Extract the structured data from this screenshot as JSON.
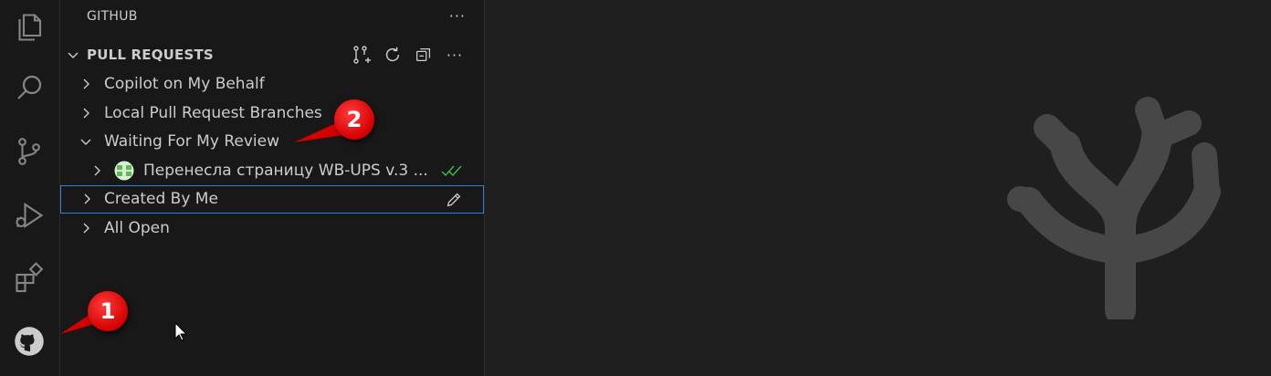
{
  "activity_bar": {
    "items": [
      {
        "icon": "explorer-icon"
      },
      {
        "icon": "search-icon"
      },
      {
        "icon": "source-control-icon"
      },
      {
        "icon": "run-debug-icon"
      },
      {
        "icon": "extensions-icon"
      },
      {
        "icon": "github-icon"
      }
    ]
  },
  "sidebar": {
    "title": "GITHUB",
    "more": "···",
    "section": {
      "label": "PULL REQUESTS",
      "actions": [
        "create-pull-request-icon",
        "refresh-icon",
        "collapse-all-icon",
        "more-icon"
      ],
      "more": "···"
    },
    "tree": [
      {
        "label": "Copilot on My Behalf",
        "expanded": false
      },
      {
        "label": "Local Pull Request Branches",
        "expanded": false
      },
      {
        "label": "Waiting For My Review",
        "expanded": true
      },
      {
        "label": "Перенесла страницу WB-UPS v.3 ...",
        "expanded": false,
        "child": true,
        "status": "approved-check-icon"
      },
      {
        "label": "Created By Me",
        "expanded": false,
        "selected": true,
        "action": "edit-icon"
      },
      {
        "label": "All Open",
        "expanded": false
      }
    ]
  },
  "annotations": [
    {
      "number": "1"
    },
    {
      "number": "2"
    }
  ],
  "colors": {
    "background": "#1f1f1f",
    "sidebar": "#181818",
    "selection_border": "#2f7fd4",
    "badge_red": "#e00000",
    "check_green": "#3fb950",
    "watermark": "#474747"
  }
}
